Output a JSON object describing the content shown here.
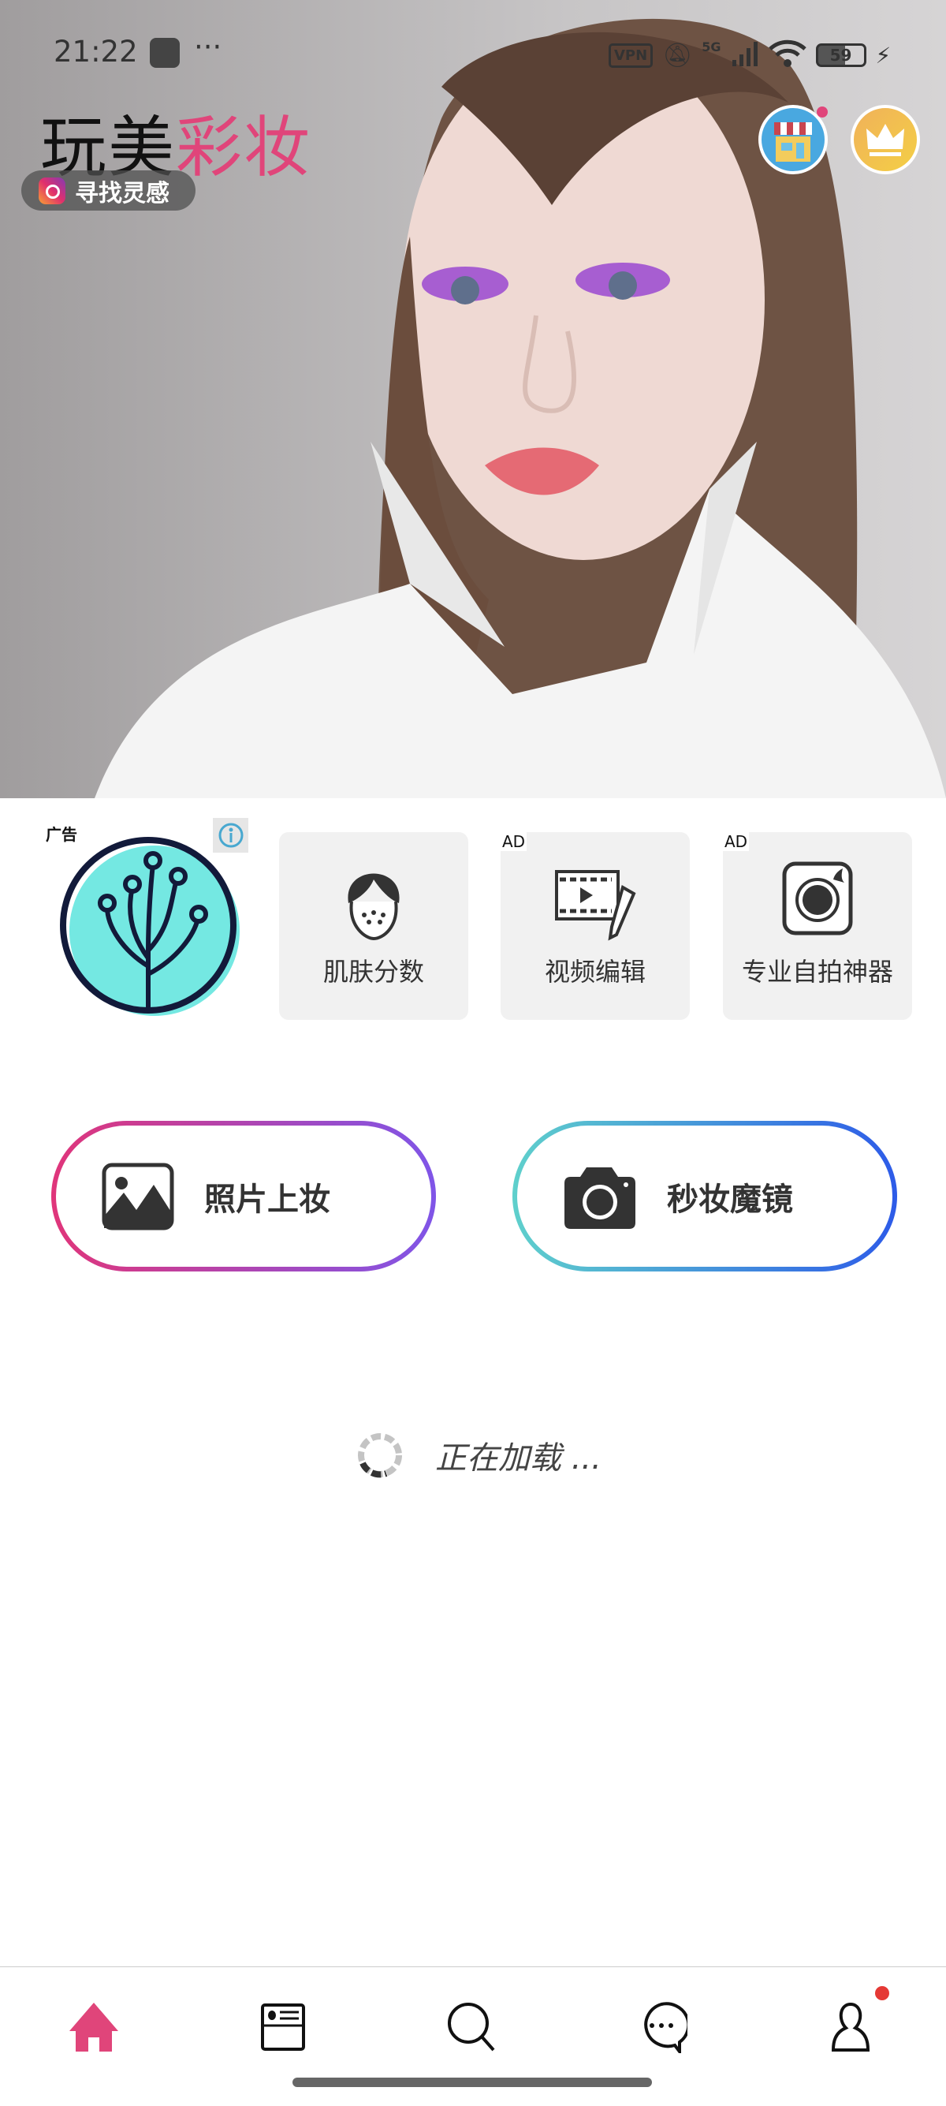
{
  "status_bar": {
    "time": "21:22",
    "more": "···",
    "vpn": "VPN",
    "network": "5G",
    "battery": "59"
  },
  "header": {
    "title_black": "玩美",
    "title_pink": "彩妆",
    "inspiration_label": "寻找灵感",
    "store_icon": "store-icon",
    "vip_icon": "crown-icon"
  },
  "features": {
    "ad_label": "广告",
    "tiles": [
      {
        "label": "肌肤分数",
        "ad": ""
      },
      {
        "label": "视频编辑",
        "ad": "AD"
      },
      {
        "label": "专业自拍神器",
        "ad": "AD"
      }
    ]
  },
  "actions": {
    "photo_makeup": "照片上妆",
    "live_mirror": "秒妆魔镜"
  },
  "loading": {
    "text": "正在加载 ..."
  },
  "colors": {
    "accent": "#e0457a",
    "grad_left": [
      "#e0357a",
      "#7f55e8"
    ],
    "grad_right": [
      "#5fd0cc",
      "#2d5be8"
    ]
  },
  "bottom_nav": [
    "home",
    "feed",
    "search",
    "messages",
    "profile"
  ]
}
